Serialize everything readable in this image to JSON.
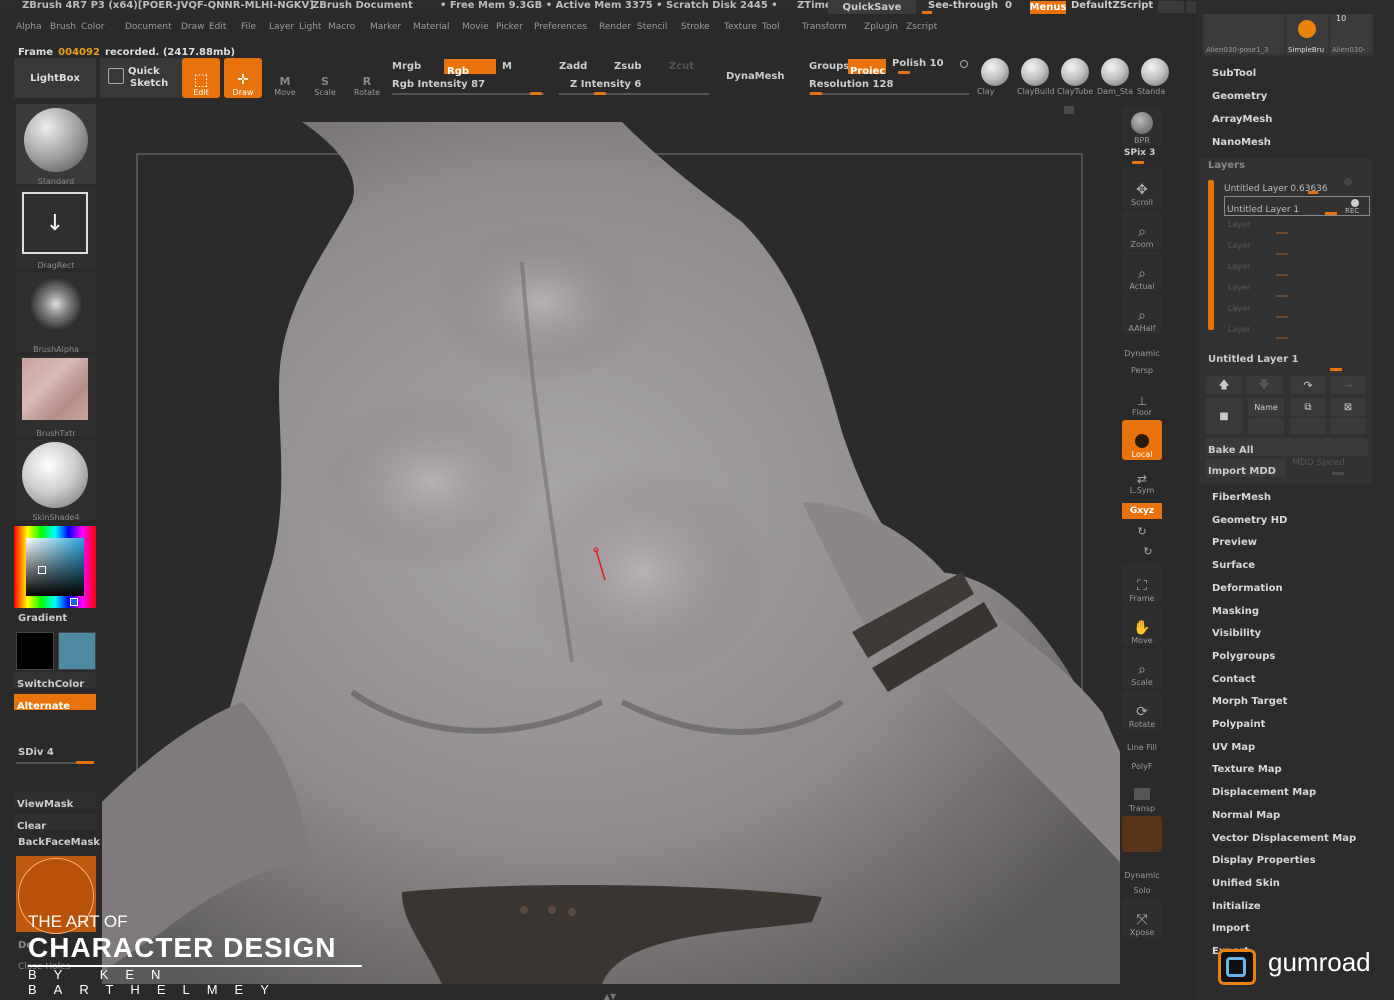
{
  "titlebar": {
    "app": "ZBrush 4R7 P3 (x64)[POER-JVQF-QNNR-MLHI-NGKV]",
    "document": "ZBrush Document",
    "mem": "• Free Mem 9.3GB • Active Mem 3375 • Scratch Disk 2445 •",
    "ztime": "ZTime",
    "quicksave": "QuickSave",
    "seethrough": "See-through",
    "seethrough_value": "0",
    "menus": "Menus",
    "script": "DefaultZScript"
  },
  "menubar": [
    "Alpha",
    "Brush",
    "Color",
    "Document",
    "Draw",
    "Edit",
    "File",
    "Layer",
    "Light",
    "Macro",
    "Marker",
    "Material",
    "Movie",
    "Picker",
    "Preferences",
    "Render",
    "Stencil",
    "Stroke",
    "Texture",
    "Tool",
    "Transform",
    "Zplugin",
    "Zscript"
  ],
  "status": {
    "frame_label": "Frame",
    "frame_num": "004092",
    "recorded": "recorded. (2417.88mb)"
  },
  "toolbar": {
    "lightbox": "LightBox",
    "quick": "Quick",
    "sketch": "Sketch",
    "edit": "Edit",
    "draw": "Draw",
    "move": "Move",
    "scale": "Scale",
    "rotate": "Rotate",
    "mrgb": "Mrgb",
    "rgb": "Rgb",
    "m": "M",
    "rgb_intensity": "Rgb Intensity 87",
    "zadd": "Zadd",
    "zsub": "Zsub",
    "zcut": "Zcut",
    "z_intensity": "Z Intensity 6",
    "dynamesh": "DynaMesh",
    "groups": "Groups",
    "projec": "Projec",
    "polish": "Polish 10",
    "resolution": "Resolution 128",
    "brushes": [
      "Clay",
      "ClayBuild",
      "ClayTube",
      "Dam_Sta",
      "Standa"
    ]
  },
  "left": {
    "brush": "Standard",
    "stroke": "DragRect",
    "alpha": "BrushAlpha",
    "texture": "BrushTxtr",
    "material": "SkinShade4",
    "gradient": "Gradient",
    "switchcolor": "SwitchColor",
    "alternate": "Alternate",
    "sdiv": "SDiv 4",
    "viewmask": "ViewMask",
    "clear": "Clear",
    "backfacemask": "BackFaceMask",
    "de": "De",
    "close_holes": "Close Holes"
  },
  "colors": {
    "primary": "#000000",
    "secondary": "#4f8aa3",
    "accent": "#e8720c"
  },
  "rightshelf": {
    "bpr": "BPR",
    "spix": "SPix 3",
    "scroll": "Scroll",
    "zoom": "Zoom",
    "actual": "Actual",
    "aahalf": "AAHalf",
    "dynamic": "Dynamic",
    "persp": "Persp",
    "floor": "Floor",
    "local": "Local",
    "lsym": "L.Sym",
    "xyz": "Gxyz",
    "frame": "Frame",
    "move": "Move",
    "scale": "Scale",
    "rotate": "Rotate",
    "linefill": "Line Fill",
    "polyf": "PolyF",
    "transp": "Transp",
    "dynamic2": "Dynamic",
    "solo": "Solo",
    "xpose": "Xpose"
  },
  "tools": {
    "thumbs": [
      "Alien030-pose1_3",
      "SimpleBru",
      "Alien030-"
    ],
    "count": "10"
  },
  "rightpanel": {
    "top_menus": [
      "SubTool",
      "Geometry",
      "ArrayMesh",
      "NanoMesh"
    ],
    "layers_title": "Layers",
    "layer1": "Untitled Layer 0.63636",
    "layer2": "Untitled Layer 1",
    "empty_layers": [
      "Layer",
      "Layer",
      "Layer",
      "Layer",
      "Layer",
      "Layer"
    ],
    "rec": "REC",
    "selected_layer": "Untitled Layer 1",
    "name_btn": "Name",
    "bake_all": "Bake All",
    "import_mdd": "Import MDD",
    "mdd_speed": "MDD Speed",
    "menus": [
      "FiberMesh",
      "Geometry HD",
      "Preview",
      "Surface",
      "Deformation",
      "Masking",
      "Visibility",
      "Polygroups",
      "Contact",
      "Morph Target",
      "Polypaint",
      "UV Map",
      "Texture Map",
      "Displacement Map",
      "Normal Map",
      "Vector Displacement Map",
      "Display Properties",
      "Unified Skin",
      "Initialize",
      "Import",
      "Export"
    ]
  },
  "watermark": {
    "line1": "THE ART OF",
    "line2": "CHARACTER DESIGN",
    "line3": "BY KEN BARTHELMEY",
    "gumroad": "gumroad"
  }
}
